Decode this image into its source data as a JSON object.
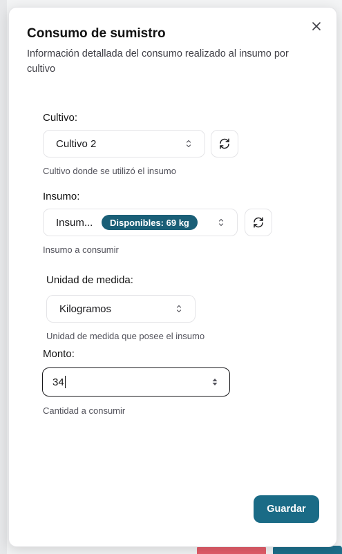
{
  "dialog": {
    "title": "Consumo de sumistro",
    "subtitle": "Información detallada del consumo realizado al insumo por cultivo"
  },
  "cultivo": {
    "label": "Cultivo:",
    "value": "Cultivo 2",
    "hint": "Cultivo donde se utilizó el insumo"
  },
  "insumo": {
    "label": "Insumo:",
    "value": "Insum...",
    "badge": "Disponibles: 69 kg",
    "hint": "Insumo a consumir"
  },
  "unidad": {
    "label": "Unidad de medida:",
    "value": "Kilogramos",
    "hint": "Unidad de medida que posee el insumo"
  },
  "monto": {
    "label": "Monto:",
    "value": "34",
    "hint": "Cantidad a consumir"
  },
  "actions": {
    "save_label": "Guardar"
  },
  "icons": {
    "close": "close-icon",
    "refresh": "refresh-icon",
    "chevron": "chevron-updown-icon",
    "stepper": "stepper-icon"
  },
  "colors": {
    "primary": "#1a6b86",
    "badge": "#1a5f77"
  }
}
